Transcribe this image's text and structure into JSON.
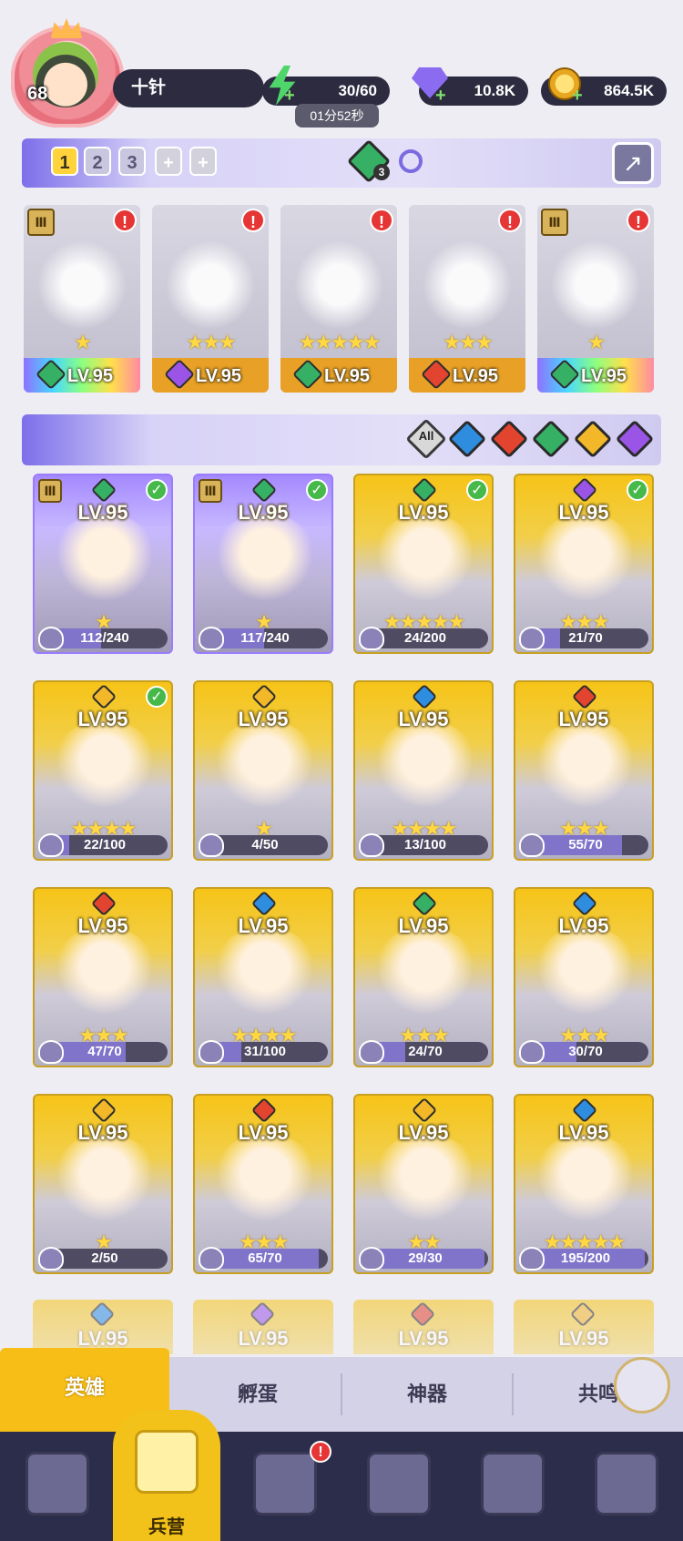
{
  "player": {
    "level": "68",
    "name": "十针"
  },
  "resources": {
    "energy": "30/60",
    "energy_timer": "01分52秒",
    "gems": "10.8K",
    "coins": "864.5K"
  },
  "team_tabs": [
    "1",
    "2",
    "3"
  ],
  "element_filter": {
    "all_label": "All",
    "gem_count": "3"
  },
  "team": [
    {
      "level": "LV.95",
      "element": "green",
      "stars": "★",
      "alert": "!"
    },
    {
      "level": "LV.95",
      "element": "purple",
      "stars": "★★★",
      "alert": "!"
    },
    {
      "level": "LV.95",
      "element": "green",
      "stars": "★★★★★",
      "alert": "!"
    },
    {
      "level": "LV.95",
      "element": "red",
      "stars": "★★★",
      "alert": "!"
    },
    {
      "level": "LV.95",
      "element": "green",
      "stars": "★",
      "alert": "!"
    }
  ],
  "heroes": [
    {
      "level": "LV.95",
      "progress": "112/240",
      "fraction": 0.47,
      "element": "green",
      "stars": "★",
      "checked": true,
      "rank": "III"
    },
    {
      "level": "LV.95",
      "progress": "117/240",
      "fraction": 0.49,
      "element": "green",
      "stars": "★",
      "checked": true,
      "rank": "III"
    },
    {
      "level": "LV.95",
      "progress": "24/200",
      "fraction": 0.12,
      "element": "green",
      "stars": "★★★★★",
      "checked": true
    },
    {
      "level": "LV.95",
      "progress": "21/70",
      "fraction": 0.3,
      "element": "purple",
      "stars": "★★★",
      "checked": true
    },
    {
      "level": "LV.95",
      "progress": "22/100",
      "fraction": 0.22,
      "element": "yellow",
      "stars": "★★★★",
      "checked": true
    },
    {
      "level": "LV.95",
      "progress": "4/50",
      "fraction": 0.08,
      "element": "yellow",
      "stars": "★",
      "checked": false
    },
    {
      "level": "LV.95",
      "progress": "13/100",
      "fraction": 0.13,
      "element": "blue",
      "stars": "★★★★",
      "checked": false
    },
    {
      "level": "LV.95",
      "progress": "55/70",
      "fraction": 0.79,
      "element": "red",
      "stars": "★★★",
      "checked": false
    },
    {
      "level": "LV.95",
      "progress": "47/70",
      "fraction": 0.67,
      "element": "red",
      "stars": "★★★",
      "checked": false
    },
    {
      "level": "LV.95",
      "progress": "31/100",
      "fraction": 0.31,
      "element": "blue",
      "stars": "★★★★",
      "checked": false
    },
    {
      "level": "LV.95",
      "progress": "24/70",
      "fraction": 0.34,
      "element": "green",
      "stars": "★★★",
      "checked": false
    },
    {
      "level": "LV.95",
      "progress": "30/70",
      "fraction": 0.43,
      "element": "blue",
      "stars": "★★★",
      "checked": false
    },
    {
      "level": "LV.95",
      "progress": "2/50",
      "fraction": 0.04,
      "element": "yellow",
      "stars": "★",
      "checked": false
    },
    {
      "level": "LV.95",
      "progress": "65/70",
      "fraction": 0.93,
      "element": "red",
      "stars": "★★★",
      "checked": false
    },
    {
      "level": "LV.95",
      "progress": "29/30",
      "fraction": 0.97,
      "element": "yellow",
      "stars": "★★",
      "checked": false
    },
    {
      "level": "LV.95",
      "progress": "195/200",
      "fraction": 0.97,
      "element": "blue",
      "stars": "★★★★★",
      "checked": false
    }
  ],
  "partial_row": [
    {
      "level": "LV.95",
      "element": "blue"
    },
    {
      "level": "LV.95",
      "element": "purple"
    },
    {
      "level": "LV.95",
      "element": "red"
    },
    {
      "level": "LV.95",
      "element": "yellow"
    }
  ],
  "subtabs": [
    "英雄",
    "孵蛋",
    "神器",
    "共鸣"
  ],
  "bottom_nav": [
    {
      "icon": "cards-icon",
      "label": ""
    },
    {
      "icon": "barracks-icon",
      "label": "兵营"
    },
    {
      "icon": "book-icon",
      "label": "",
      "alert": "!"
    },
    {
      "icon": "castle-icon",
      "label": ""
    },
    {
      "icon": "mushroom-icon",
      "label": ""
    },
    {
      "icon": "guild-icon",
      "label": ""
    }
  ],
  "colors": {
    "green": "#35b064",
    "purple": "#9a55e6",
    "red": "#e2442f",
    "blue": "#2f8de0",
    "yellow": "#f2b82a",
    "accent": "#f6be16"
  }
}
